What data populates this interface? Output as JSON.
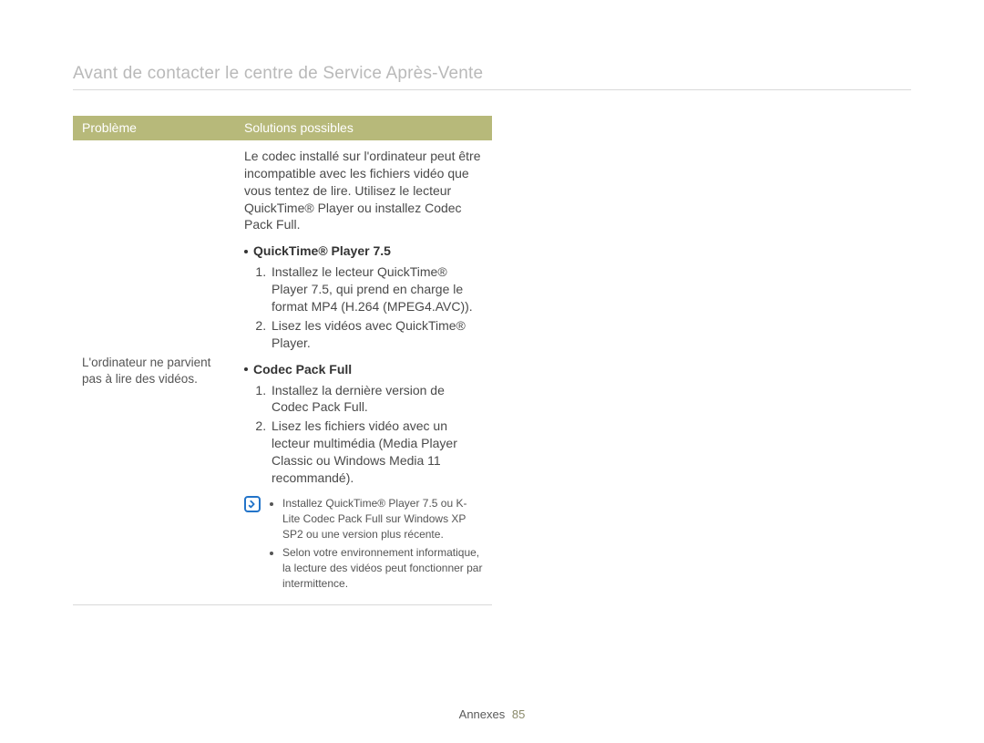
{
  "page_title": "Avant de contacter le centre de Service Après-Vente",
  "table": {
    "headers": {
      "problem": "Problème",
      "solutions": "Solutions possibles"
    },
    "row": {
      "problem": "L'ordinateur ne parvient pas à lire des vidéos.",
      "intro": "Le codec installé sur l'ordinateur peut être incompatible avec les fichiers vidéo que vous tentez de lire. Utilisez le lecteur QuickTime® Player ou installez Codec Pack Full.",
      "quicktime": {
        "heading": "QuickTime® Player 7.5",
        "steps": [
          "Installez le lecteur QuickTime® Player 7.5, qui prend en charge le format MP4 (H.264 (MPEG4.AVC)).",
          "Lisez les vidéos avec QuickTime® Player."
        ]
      },
      "codecpack": {
        "heading": "Codec Pack Full",
        "steps": [
          "Installez la dernière version de Codec Pack Full.",
          "Lisez les fichiers vidéo avec un lecteur multimédia (Media Player Classic ou Windows Media 11 recommandé)."
        ]
      },
      "notes": [
        "Installez QuickTime® Player 7.5 ou K-Lite Codec Pack Full sur Windows XP SP2 ou une version plus récente.",
        "Selon votre environnement informatique, la lecture des vidéos peut fonctionner par intermittence."
      ]
    }
  },
  "footer": {
    "section": "Annexes",
    "page_number": "85"
  }
}
